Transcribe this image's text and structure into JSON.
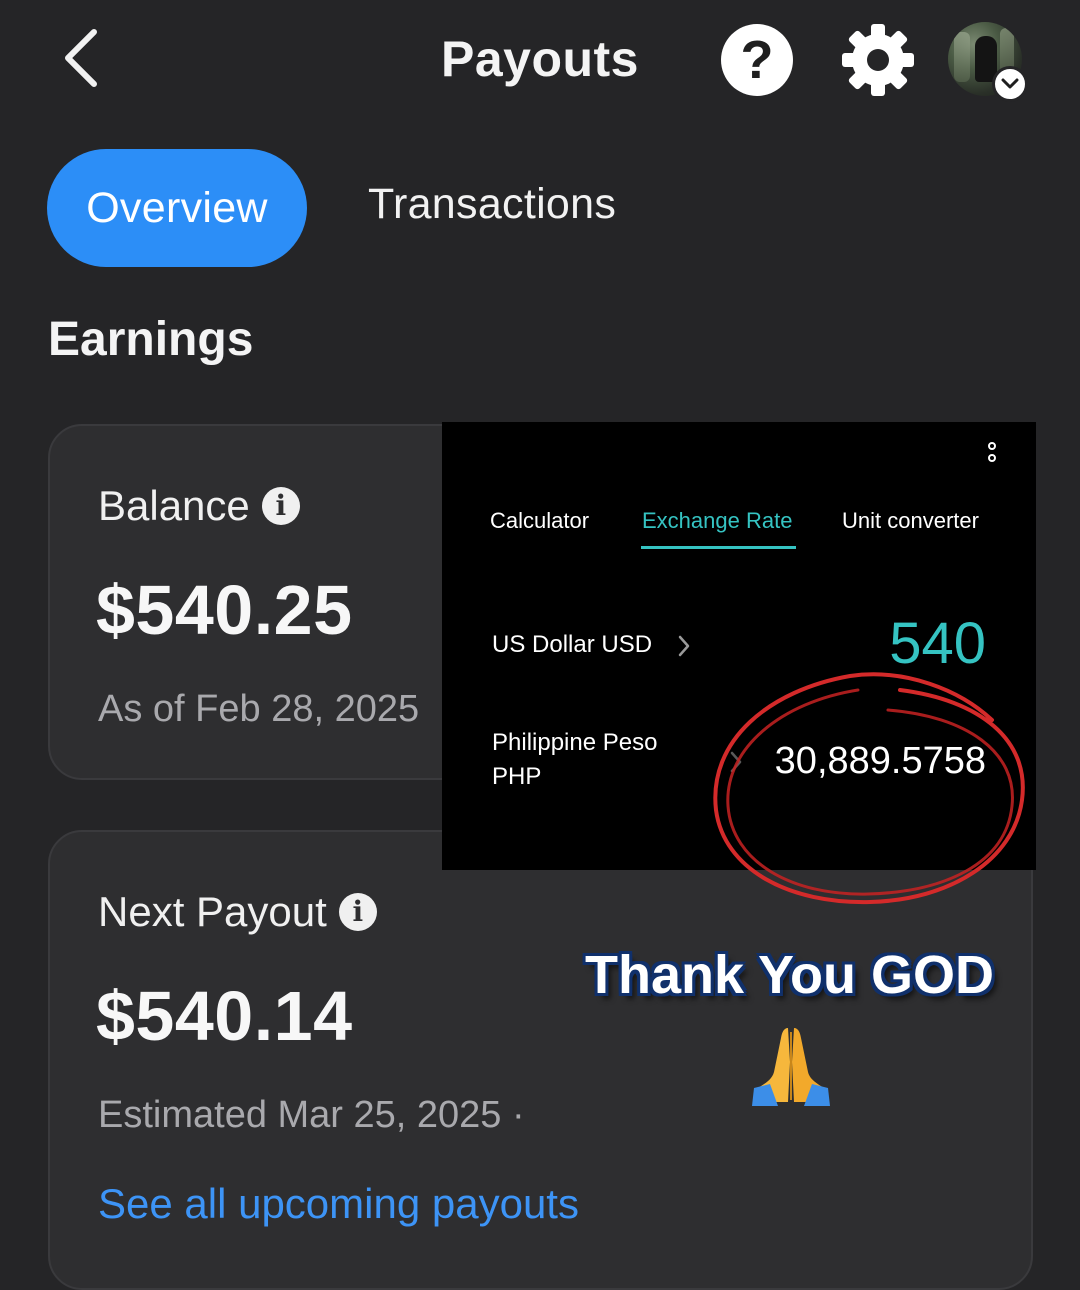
{
  "header": {
    "title": "Payouts",
    "help_label": "?"
  },
  "tabs": {
    "overview": "Overview",
    "transactions": "Transactions"
  },
  "section": {
    "title": "Earnings"
  },
  "balance_card": {
    "label": "Balance",
    "amount": "$540.25",
    "as_of": "As of Feb 28, 2025"
  },
  "payout_card": {
    "label": "Next Payout",
    "amount": "$540.14",
    "estimated": "Estimated Mar 25, 2025 ·",
    "link": "See all upcoming payouts"
  },
  "exchange_overlay": {
    "tabs": [
      "Calculator",
      "Exchange Rate",
      "Unit converter"
    ],
    "active_tab": "Exchange Rate",
    "from_currency": "US Dollar USD",
    "from_value": "540",
    "to_currency_line1": "Philippine Peso",
    "to_currency_line2": "PHP",
    "to_value": "30,889.5758"
  },
  "caption": {
    "text": "Thank You GOD",
    "emoji_icon": "praying-hands-icon"
  },
  "colors": {
    "background": "#252527",
    "card": "#2e2e30",
    "accent_blue": "#2c8ef7",
    "link_blue": "#3d94f6",
    "teal": "#35c3c2",
    "circle_red": "#d42a2a"
  }
}
